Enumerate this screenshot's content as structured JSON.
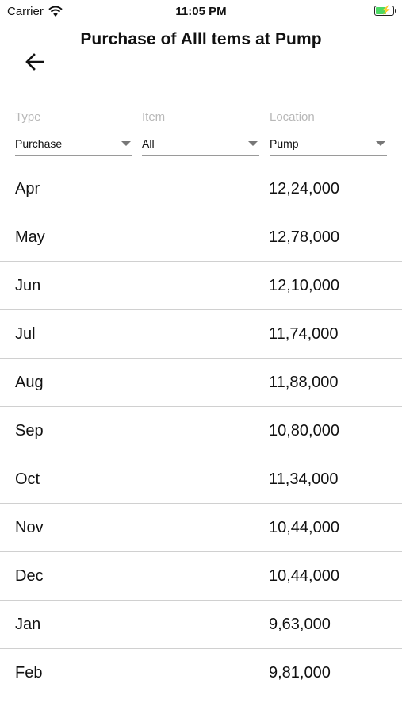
{
  "status_bar": {
    "carrier": "Carrier",
    "time": "11:05 PM"
  },
  "header": {
    "title": "Purchase of Alll tems at Pump",
    "back_icon": "arrow-left-icon"
  },
  "filters": [
    {
      "label": "Type",
      "value": "Purchase"
    },
    {
      "label": "Item",
      "value": "All"
    },
    {
      "label": "Location",
      "value": "Pump"
    }
  ],
  "rows": [
    {
      "month": "Apr",
      "amount": "12,24,000"
    },
    {
      "month": "May",
      "amount": "12,78,000"
    },
    {
      "month": "Jun",
      "amount": "12,10,000"
    },
    {
      "month": "Jul",
      "amount": "11,74,000"
    },
    {
      "month": "Aug",
      "amount": "11,88,000"
    },
    {
      "month": "Sep",
      "amount": "10,80,000"
    },
    {
      "month": "Oct",
      "amount": "11,34,000"
    },
    {
      "month": "Nov",
      "amount": "10,44,000"
    },
    {
      "month": "Dec",
      "amount": "10,44,000"
    },
    {
      "month": "Jan",
      "amount": "9,63,000"
    },
    {
      "month": "Feb",
      "amount": "9,81,000"
    }
  ]
}
